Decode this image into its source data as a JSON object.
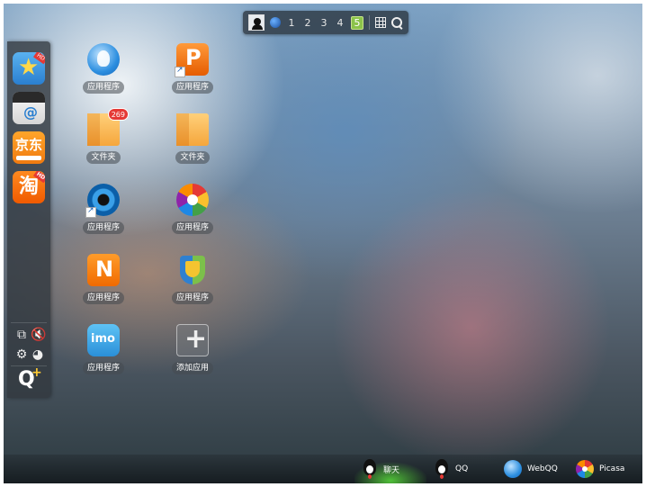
{
  "topbar": {
    "workspaces": [
      "1",
      "2",
      "3",
      "4",
      "5"
    ],
    "active_workspace": "5",
    "icons": [
      "avatar",
      "desktop-icon",
      "app-grid-icon",
      "search-icon"
    ]
  },
  "dock": {
    "apps": [
      {
        "name": "star-app",
        "badge": "HD"
      },
      {
        "name": "mail-app",
        "glyph": "@"
      },
      {
        "name": "jd-app",
        "text": "京东",
        "subtext": "360buy.com"
      },
      {
        "name": "taobao-app",
        "text": "淘",
        "badge": "HD"
      }
    ],
    "tools": [
      "layout-icon",
      "mute-icon",
      "gear-icon",
      "palette-icon"
    ],
    "qplus": "Q"
  },
  "desktop": {
    "icons": [
      {
        "label": "应用程序"
      },
      {
        "label": "应用程序"
      },
      {
        "label": "文件夹",
        "badge": "269"
      },
      {
        "label": "文件夹"
      },
      {
        "label": "应用程序"
      },
      {
        "label": "应用程序"
      },
      {
        "label": "应用程序"
      },
      {
        "label": "应用程序"
      },
      {
        "label": "应用程序"
      },
      {
        "label": "添加应用"
      }
    ]
  },
  "taskbar": {
    "items": [
      {
        "label": "聊天",
        "active": true
      },
      {
        "label": "QQ"
      },
      {
        "label": "WebQQ"
      },
      {
        "label": "Picasa"
      }
    ]
  },
  "colors": {
    "active_workspace": "#8bc34a",
    "badge_red": "#e53935",
    "active_task_glow": "#5adc3c"
  }
}
